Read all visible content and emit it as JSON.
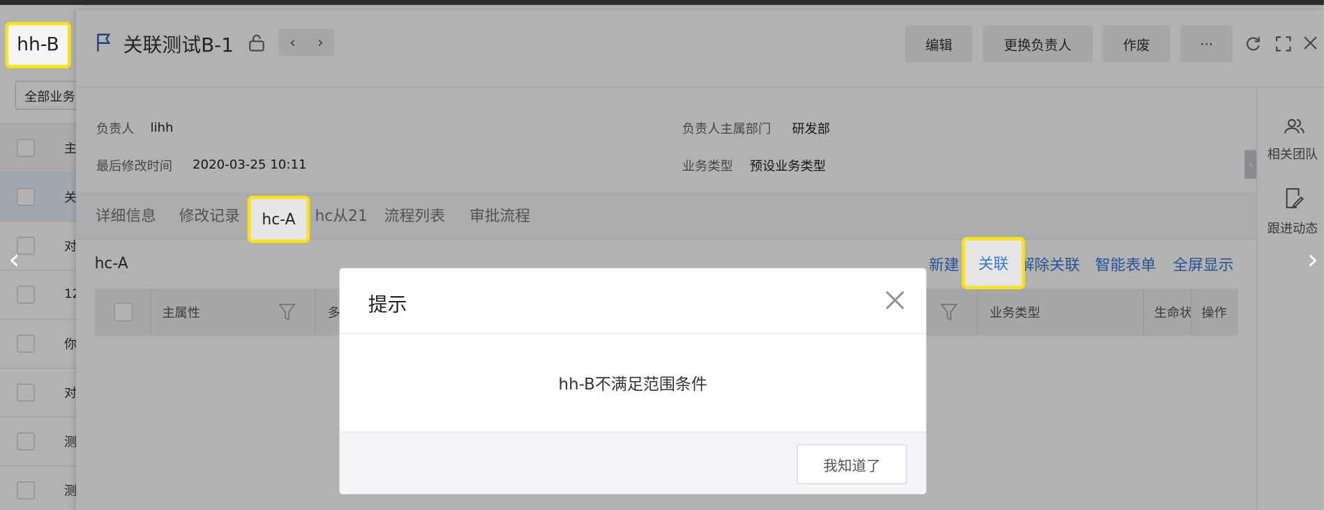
{
  "left_list": {
    "highlighted_label": "hh-B",
    "filter_select": "全部业务",
    "header_cell": "主",
    "rows": [
      "关",
      "对",
      "12",
      "你",
      "对",
      "测",
      "测"
    ]
  },
  "detail": {
    "title": "关联测试B-1",
    "nav_prev": "‹",
    "nav_next": "›",
    "buttons": {
      "edit": "编辑",
      "change_owner": "更换负责人",
      "void": "作废",
      "more": "···"
    },
    "fields": {
      "owner_label": "负责人",
      "owner_value": "lihh",
      "modified_label": "最后修改时间",
      "modified_value": "2020-03-25 10:11",
      "dept_label": "负责人主属部门",
      "dept_value": "研发部",
      "biztype_label": "业务类型",
      "biztype_value": "预设业务类型"
    },
    "tabs": [
      "详细信息",
      "修改记录",
      "hc-A",
      "hc从21",
      "流程列表",
      "审批流程"
    ],
    "section_title": "hc-A",
    "actions": {
      "new": "新建",
      "link": "关联",
      "unlink": "解除关联",
      "smart_form": "智能表单",
      "fullscreen": "全屏显示"
    },
    "columns": {
      "main_attr": "主属性",
      "multi": "多",
      "biz_type": "业务类型",
      "lifecycle": "生命状",
      "ops": "操作"
    },
    "side": {
      "team": "相关团队",
      "follow": "跟进动态"
    }
  },
  "modal": {
    "title": "提示",
    "message": "hh-B不满足范围条件",
    "ok_button": "我知道了"
  },
  "colors": {
    "accent": "#3a78d5",
    "highlight": "#f7e21c",
    "overlay": "rgba(0,0,0,0.30)"
  }
}
